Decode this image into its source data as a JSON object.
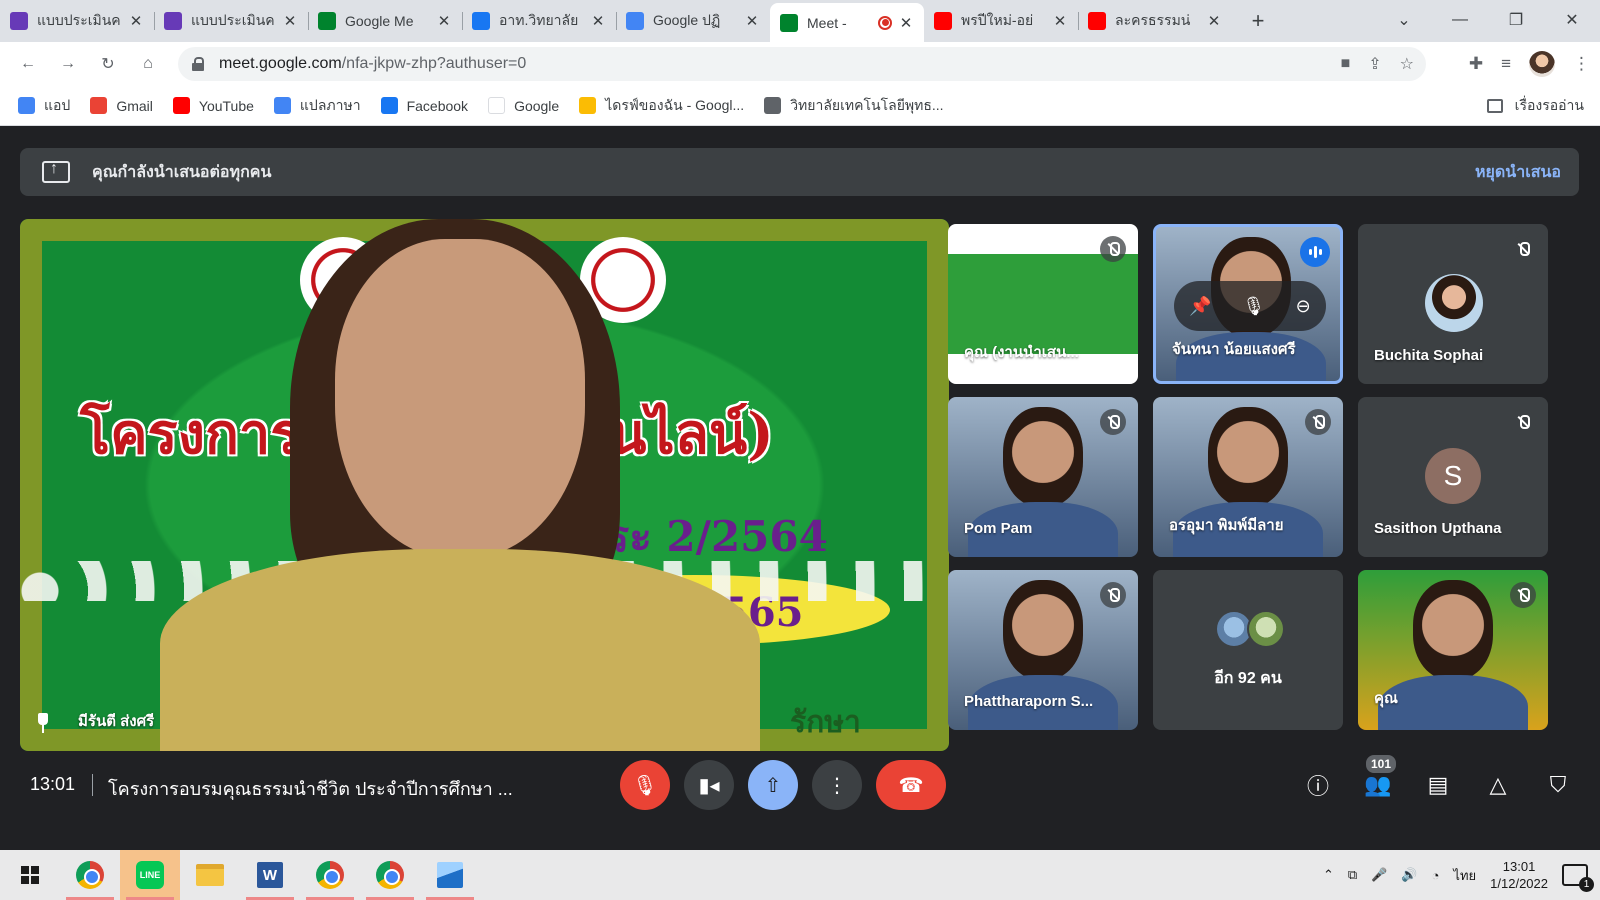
{
  "browser": {
    "tabs": [
      {
        "title": "แบบประเมินค",
        "favicon": "forms-icon",
        "color": "#673ab7"
      },
      {
        "title": "แบบประเมินค",
        "favicon": "forms-icon",
        "color": "#673ab7"
      },
      {
        "title": "Google Me",
        "favicon": "meet-icon",
        "color": "#00832d"
      },
      {
        "title": "อาท.วิทยาลัย",
        "favicon": "facebook-icon",
        "color": "#1877f2"
      },
      {
        "title": "Google ปฏิ",
        "favicon": "calendar-icon",
        "color": "#4285f4"
      },
      {
        "title": "Meet -",
        "favicon": "meet-icon",
        "color": "#00832d",
        "active": true,
        "recording": true
      },
      {
        "title": "พรปีใหม่-อย่",
        "favicon": "youtube-icon",
        "color": "#ff0000"
      },
      {
        "title": "ละครธรรมน่",
        "favicon": "youtube-icon",
        "color": "#ff0000"
      }
    ],
    "url_host": "meet.google.com",
    "url_path": "/nfa-jkpw-zhp?authuser=0",
    "bookmarks": [
      {
        "label": "แอป",
        "icon": "apps-grid-icon",
        "color": "#4285f4"
      },
      {
        "label": "Gmail",
        "icon": "gmail-icon",
        "color": "#ea4335"
      },
      {
        "label": "YouTube",
        "icon": "youtube-icon",
        "color": "#ff0000"
      },
      {
        "label": "แปลภาษา",
        "icon": "translate-icon",
        "color": "#4285f4"
      },
      {
        "label": "Facebook",
        "icon": "facebook-icon",
        "color": "#1877f2"
      },
      {
        "label": "Google",
        "icon": "google-icon",
        "color": "#ffffff"
      },
      {
        "label": "ไดรฟ์ของฉัน - Googl...",
        "icon": "drive-icon",
        "color": "#fbbc04"
      },
      {
        "label": "วิทยาลัยเทคโนโลยีพุทธ...",
        "icon": "globe-icon",
        "color": "#5f6368"
      }
    ],
    "reading_list": "เรื่องรออ่าน"
  },
  "meet": {
    "banner_text": "คุณกำลังนำเสนอต่อทุกคน",
    "stop_presenting": "หยุดนำเสนอ",
    "main_tile": {
      "name": "มีรันตี ส่งศรี",
      "banner_line1": "โครงการอบ      ชีวิต (ออนไลน์)",
      "banner_line2": "ประ         2/2564",
      "banner_year": "565",
      "banner_suffix": "รักษา"
    },
    "participants": [
      {
        "name": "คุณ (งานนำเสน...",
        "kind": "screen"
      },
      {
        "name": "จันทนา น้อยแสงศรี",
        "kind": "video",
        "speaking": true
      },
      {
        "name": "Buchita Sophai",
        "kind": "photo"
      },
      {
        "name": "Pom Pam",
        "kind": "video"
      },
      {
        "name": "อรอุมา พิมพ์มีลาย",
        "kind": "video"
      },
      {
        "name": "Sasithon Upthana",
        "kind": "letter",
        "letter": "S"
      },
      {
        "name": "Phattharaporn S...",
        "kind": "video"
      },
      {
        "name": "อีก 92 คน",
        "kind": "more"
      },
      {
        "name": "คุณ",
        "kind": "self"
      }
    ],
    "clock": "13:01",
    "meeting_title": "โครงการอบรมคุณธรรมนำชีวิต ประจำปีการศึกษา ...",
    "participant_count": "101",
    "accent_colors": {
      "danger": "#ea4335",
      "present": "#8ab4f8",
      "link": "#8ab4f8"
    }
  },
  "taskbar": {
    "language": "ไทย",
    "time": "13:01",
    "date": "1/12/2022",
    "notifications": "1"
  }
}
